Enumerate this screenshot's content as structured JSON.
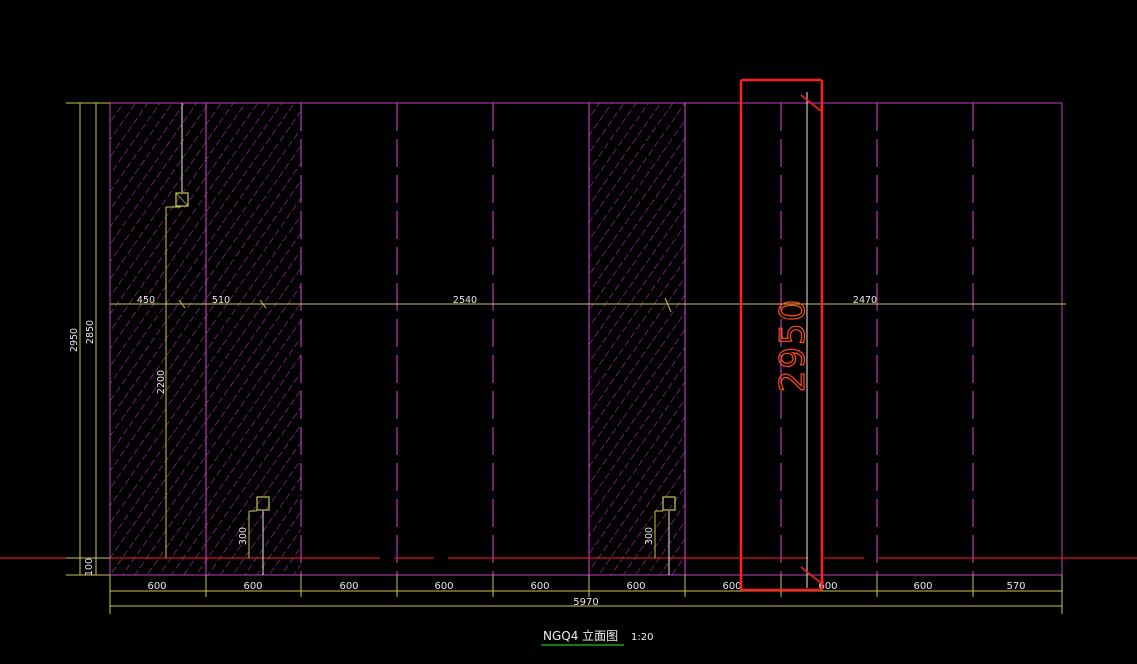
{
  "drawing": {
    "title": "NGQ4 立面图",
    "scale": "1:20",
    "colors": {
      "background": "#000000",
      "wall_outline": "#c040c0",
      "dash_lines": "#e040e0",
      "hatch": "#c040c0",
      "dimension": "#c8c850",
      "text": "#e8e8e8",
      "ground_line": "#ff2020",
      "highlight_box": "#ff2020",
      "highlight_text": "#ff4a1a",
      "title_underline": "#20c020",
      "marker_fill": "#c8c850"
    },
    "bottom_dims": [
      "600",
      "600",
      "600",
      "600",
      "600",
      "600",
      "600",
      "600",
      "600",
      "570"
    ],
    "overall_width": "5970",
    "left_dims": {
      "overall": "2950",
      "inner": "2850",
      "bottom": "100"
    },
    "mid_dims": [
      "450",
      "510",
      "2540",
      "2470"
    ],
    "opening_height": "2200",
    "marker_heights": [
      "300",
      "300"
    ],
    "callout": "2950"
  }
}
